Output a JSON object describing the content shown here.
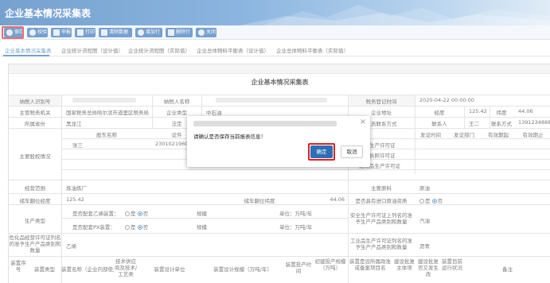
{
  "app_title": "企业基本情况采集表",
  "toolbar": [
    {
      "label": "保存",
      "icon": "save-icon"
    },
    {
      "label": "校验",
      "icon": "check-icon"
    },
    {
      "label": "申报",
      "icon": "declare-icon"
    },
    {
      "label": "打印",
      "icon": "print-icon"
    },
    {
      "label": "清除数据",
      "icon": "clear-icon"
    },
    {
      "label": "增加行",
      "icon": "add-row-icon"
    },
    {
      "label": "删除行",
      "icon": "delete-row-icon"
    },
    {
      "label": "关闭",
      "icon": "close-icon"
    }
  ],
  "tabs": [
    "企业基本情况采集表",
    "企业统计流程图（设计值）",
    "企业统计流程图（实际值）",
    "企业总体物料平衡表（设计值）",
    "企业总体物料平衡表（实际值）"
  ],
  "form": {
    "title": "企业基本情况采集表",
    "taxpayer_id_label": "纳税人识别号",
    "taxpayer_name_label": "纳税人名称",
    "tax_reg_time_label": "税务登记时间",
    "tax_reg_time_value": "2020-04-22 00:00:00",
    "tax_authority_label": "主管税务机关",
    "tax_authority_value": "国家税务总局哈尔滨市道里区税务局",
    "enterprise_type_label": "企业类型",
    "enterprise_type_value": "中石油",
    "location_label": "企业地址",
    "longitude_label": "经度",
    "longitude_value": "125.42",
    "latitude_label": "纬度",
    "latitude_value": "44.06",
    "province_label": "所属省份",
    "province_value": "黑龙江",
    "legal_rep_label": "法定",
    "contact_label": "人员联系方式",
    "contact_person_label": "联系人",
    "contact_person_value": "王二",
    "contact_phone_label": "联系方式",
    "contact_phone_value": "13912348888",
    "shareholder_label": "主要股权情况",
    "shareholder_name_col": "股东名称",
    "cert_col": "证件",
    "shareholder_value": "张三",
    "cert_value": "2301021960",
    "issue_time_col": "发证时间",
    "issue_dept_col": "发证部门",
    "valid_from_col": "有效期起",
    "valid_to_col": "有效期止",
    "prod_license_1": "安全生产许可证",
    "prod_license_2": "营业执照许可证",
    "prod_license_3": "危化品生产许可证",
    "scope_label": "经营范围",
    "scope_value": "炼油炼厂",
    "main_material_label": "主要原料",
    "main_material_value": "原油",
    "longitude2_label": "储车翻位经度",
    "longitude2_value": "125.42",
    "latitude2_label": "储车翻位纬度",
    "latitude2_value": "44.06",
    "import_label": "是否具有进口原油资质",
    "yes": "是",
    "no": "否",
    "prod_type_label": "生产类型",
    "ethylene_label": "是否配套乙烯装置：",
    "px_label": "是否配套PX装置：",
    "scale_label": "规模",
    "unit_label": "单位：万吨/年",
    "safety_label": "安全生产许可证上列名的准予生产产品类别和数量",
    "safety_value": "汽油",
    "hazchem_label": "危化品经营许可证列名的准予生产产品类别和数量",
    "hazchem_value": "乙烯",
    "industry_label": "工业品生产许可证列名的准予生产产品类别和数量",
    "industry_value": "沥青",
    "bottom_cols": [
      "装置序号",
      "装置类型",
      "装置名称（企业内部使用）",
      "技术供应商及技术/工艺类",
      "装置设计单位",
      "装置设计规模（万吨/年）",
      "装置投产时间",
      "初建投产规模（万吨）",
      "装置是设所属政准或备案项目名",
      "建设批复主体项",
      "建设批复否又发生改",
      "装置目前运行状况",
      "备注"
    ]
  },
  "dialog": {
    "message": "请确认是否保存当前报表信息！",
    "ok": "确定",
    "cancel": "取消",
    "close": "×"
  }
}
